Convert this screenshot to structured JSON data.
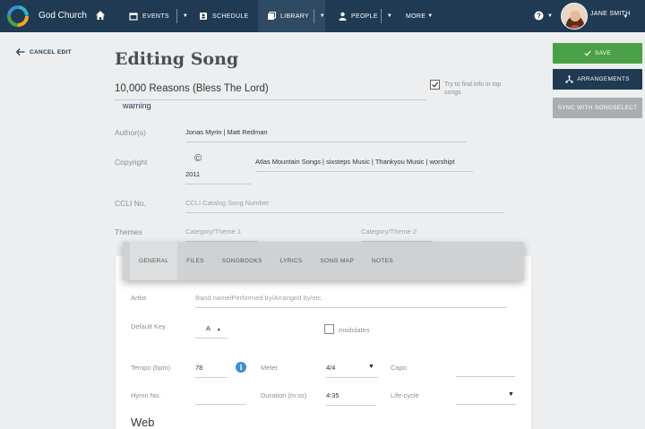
{
  "app": {
    "church_name": "God Church",
    "nav": {
      "events": "EVENTS",
      "schedule": "SCHEDULE",
      "library": "LIBRARY",
      "people": "PEOPLE",
      "more": "MORE"
    },
    "user_name": "JANE SMITH"
  },
  "actions": {
    "cancel": "CANCEL EDIT",
    "save": "SAVE",
    "arrangements": "ARRANGEMENTS",
    "sync": "SYNC WITH SONGSELECT"
  },
  "page": {
    "title": "Editing Song",
    "song_title": "10,000 Reasons (Bless The Lord)",
    "warning": "warning",
    "try_find_label": "Try to find info in top songs"
  },
  "form": {
    "authors_label": "Author(s)",
    "authors_value": "Jonas Myrin | Matt Redman",
    "copyright_label": "Copyright",
    "copyright_year": "2011",
    "copyright_holders": "Atlas Mountain Songs | sixsteps Music | Thankyou Music | worshipt",
    "ccli_label": "CCLI No.",
    "ccli_placeholder": "CCLI Catalog Song Number",
    "themes_label": "Themes",
    "theme1_placeholder": "Category/Theme 1",
    "theme2_placeholder": "Category/Theme 2"
  },
  "tabs": [
    "GENERAL",
    "FILES",
    "SONGBOOKS",
    "LYRICS",
    "SONG MAP",
    "NOTES"
  ],
  "general": {
    "artist_label": "Artist",
    "artist_placeholder": "Band name/Performed by/Arranged by/etc.",
    "default_key_label": "Default Key",
    "default_key_value": "A",
    "modulates_label": "modulates",
    "tempo_label": "Tempo (bpm)",
    "tempo_value": "78",
    "meter_label": "Meter",
    "meter_value": "4/4",
    "capo_label": "Capo",
    "hymn_label": "Hymn No.",
    "duration_label": "Duration (m:ss)",
    "duration_value": "4:35",
    "lifecycle_label": "Life-cycle",
    "web_heading": "Web"
  },
  "colors": {
    "nav_bg": "#1f3a52",
    "save": "#4aa046",
    "arrangements": "#1f3a52",
    "sync": "#a9aeb3",
    "info": "#3a8ed6"
  }
}
